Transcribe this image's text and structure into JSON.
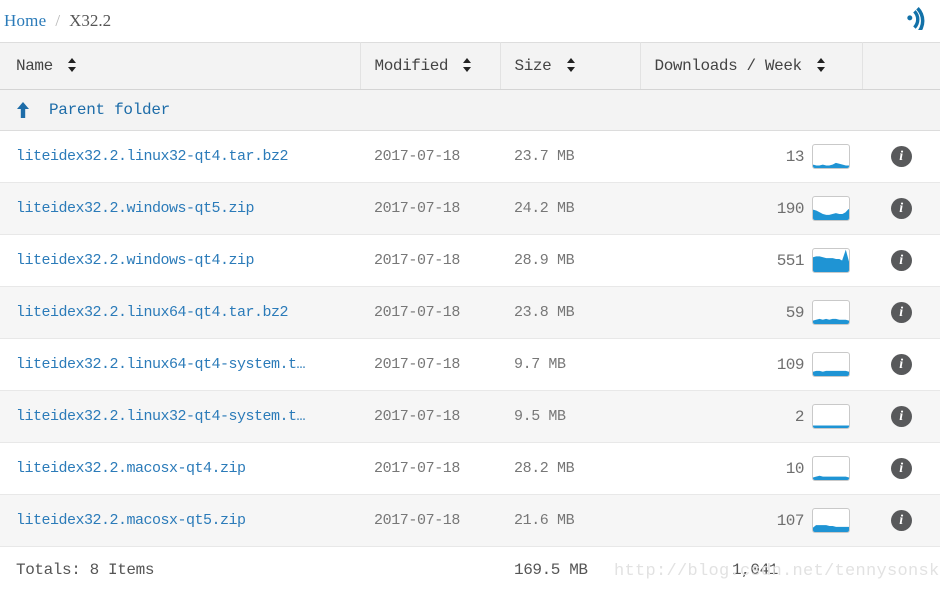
{
  "breadcrumb": {
    "home_label": "Home",
    "separator": "/",
    "current_label": "X32.2",
    "rss_icon": "rss-feed-icon"
  },
  "table": {
    "headers": {
      "name": "Name",
      "modified": "Modified",
      "size": "Size",
      "downloads": "Downloads / Week",
      "info": ""
    },
    "parent_row": {
      "icon": "up-arrow-icon",
      "label": "Parent folder"
    },
    "rows": [
      {
        "name": "liteidex32.2.linux32-qt4.tar.bz2",
        "modified": "2017-07-18",
        "size": "23.7 MB",
        "downloads": "13",
        "sparkline": [
          2,
          1,
          1,
          2,
          1,
          1,
          2,
          4,
          3,
          2,
          1,
          1
        ],
        "info_icon": "info-icon"
      },
      {
        "name": "liteidex32.2.windows-qt5.zip",
        "modified": "2017-07-18",
        "size": "24.2 MB",
        "downloads": "190",
        "sparkline": [
          10,
          9,
          7,
          5,
          4,
          4,
          5,
          6,
          5,
          5,
          7,
          11
        ],
        "info_icon": "info-icon"
      },
      {
        "name": "liteidex32.2.windows-qt4.zip",
        "modified": "2017-07-18",
        "size": "28.9 MB",
        "downloads": "551",
        "sparkline": [
          15,
          16,
          16,
          15,
          14,
          14,
          14,
          13,
          13,
          11,
          22,
          8
        ],
        "info_icon": "info-icon"
      },
      {
        "name": "liteidex32.2.linux64-qt4.tar.bz2",
        "modified": "2017-07-18",
        "size": "23.8 MB",
        "downloads": "59",
        "sparkline": [
          2,
          3,
          4,
          3,
          4,
          3,
          4,
          4,
          3,
          3,
          3,
          2
        ],
        "info_icon": "info-icon"
      },
      {
        "name": "liteidex32.2.linux64-qt4-system.t…",
        "modified": "2017-07-18",
        "size": "9.7 MB",
        "downloads": "109",
        "sparkline": [
          3,
          4,
          4,
          3,
          4,
          4,
          4,
          4,
          4,
          4,
          4,
          3
        ],
        "info_icon": "info-icon"
      },
      {
        "name": "liteidex32.2.linux32-qt4-system.t…",
        "modified": "2017-07-18",
        "size": "9.5 MB",
        "downloads": "2",
        "sparkline": [
          1,
          1,
          1,
          1,
          1,
          1,
          1,
          1,
          1,
          1,
          1,
          1
        ],
        "info_icon": "info-icon"
      },
      {
        "name": "liteidex32.2.macosx-qt4.zip",
        "modified": "2017-07-18",
        "size": "28.2 MB",
        "downloads": "10",
        "sparkline": [
          1,
          2,
          3,
          2,
          2,
          2,
          2,
          2,
          2,
          2,
          2,
          1
        ],
        "info_icon": "info-icon"
      },
      {
        "name": "liteidex32.2.macosx-qt5.zip",
        "modified": "2017-07-18",
        "size": "21.6 MB",
        "downloads": "107",
        "sparkline": [
          3,
          6,
          6,
          6,
          6,
          5,
          5,
          4,
          4,
          4,
          4,
          4
        ],
        "info_icon": "info-icon"
      }
    ],
    "totals": {
      "items_label": "Totals: 8 Items",
      "size": "169.5 MB",
      "downloads": "1,041"
    }
  },
  "watermark": {
    "text": "http://blog.csdn.net/tennysonsky"
  },
  "colors": {
    "link_blue": "#2b7bb9",
    "spark_blue": "#1f94d4",
    "info_gray": "#58595b",
    "header_bg": "#f3f3f3",
    "alt_row_bg": "#f6f6f6"
  }
}
